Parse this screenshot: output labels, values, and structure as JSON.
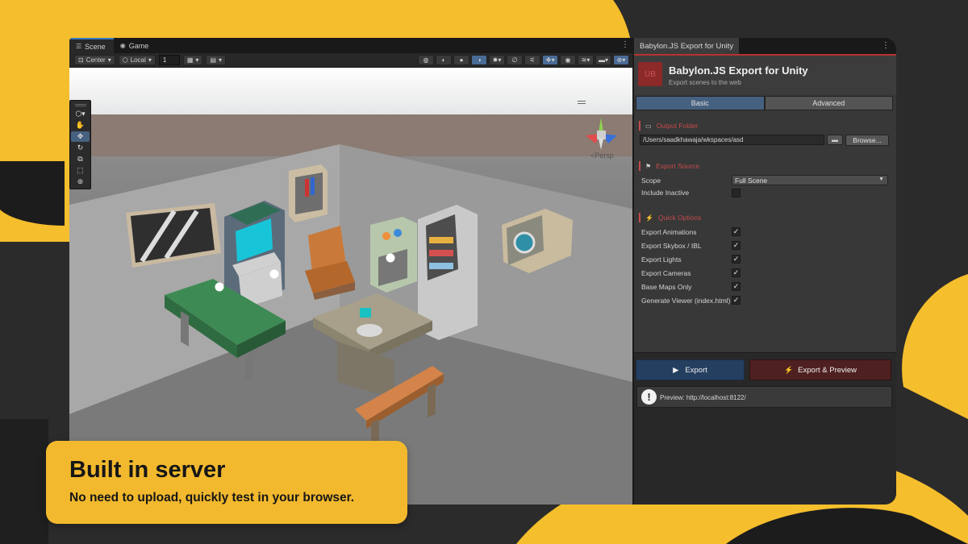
{
  "scene_tabs": [
    {
      "label": "Scene",
      "icon": "grid-icon"
    },
    {
      "label": "Game",
      "icon": "gamepad-icon"
    }
  ],
  "scene_toolbar": {
    "pivot": "Center",
    "space": "Local",
    "grid_value": "1"
  },
  "viewport": {
    "camera_label": "<Persp"
  },
  "panel": {
    "tab_label": "Babylon.JS Export for Unity",
    "logo_text": "UB",
    "title": "Babylon.JS Export for Unity",
    "subtitle": "Export scenes to the web",
    "tabs": [
      {
        "label": "Basic",
        "active": true
      },
      {
        "label": "Advanced",
        "active": false
      }
    ],
    "output_folder": {
      "title": "Output Folder",
      "path": "/Users/saadkhawaja/wkspaces/asd",
      "browse_label": "Browse..."
    },
    "export_source": {
      "title": "Export Source",
      "scope_label": "Scope",
      "scope_value": "Full Scene",
      "include_inactive_label": "Include Inactive",
      "include_inactive_checked": false
    },
    "quick_options": {
      "title": "Quick Options",
      "items": [
        {
          "label": "Export Animations",
          "checked": true
        },
        {
          "label": "Export Skybox / IBL",
          "checked": true
        },
        {
          "label": "Export Lights",
          "checked": true
        },
        {
          "label": "Export Cameras",
          "checked": true
        },
        {
          "label": "Base Maps Only",
          "checked": true
        },
        {
          "label": "Generate Viewer (index.html)",
          "checked": true
        }
      ]
    },
    "actions": {
      "export_label": "Export",
      "export_preview_label": "Export & Preview",
      "preview_notice": "Preview: http://localhost:8122/"
    }
  },
  "caption": {
    "title": "Built in server",
    "subtitle": "No need to upload, quickly test in your browser."
  },
  "colors": {
    "accent_yellow": "#f2b92e",
    "panel_red": "#b73131",
    "active_blue": "#46607f"
  }
}
